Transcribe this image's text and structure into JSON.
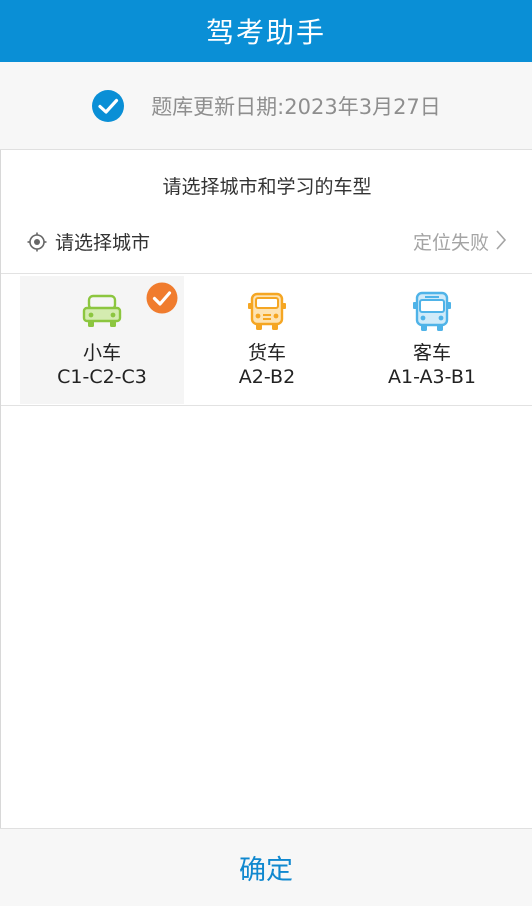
{
  "header": {
    "title": "驾考助手"
  },
  "update_bar": {
    "icon": "check-circle-icon",
    "text": "题库更新日期:2023年3月27日",
    "accent": "#0a8fd6"
  },
  "prompt": "请选择城市和学习的车型",
  "city": {
    "icon": "location-target-icon",
    "label": "请选择城市",
    "status": "定位失败"
  },
  "vehicle_types": [
    {
      "name": "小车",
      "code": "C1-C2-C3",
      "icon": "car-icon",
      "color": "#8cc63f",
      "selected": true
    },
    {
      "name": "货车",
      "code": "A2-B2",
      "icon": "truck-icon",
      "color": "#f5a623",
      "selected": false
    },
    {
      "name": "客车",
      "code": "A1-A3-B1",
      "icon": "bus-icon",
      "color": "#4fb3e8",
      "selected": false
    }
  ],
  "selection_badge_color": "#f07c2e",
  "footer": {
    "confirm_label": "确定"
  }
}
